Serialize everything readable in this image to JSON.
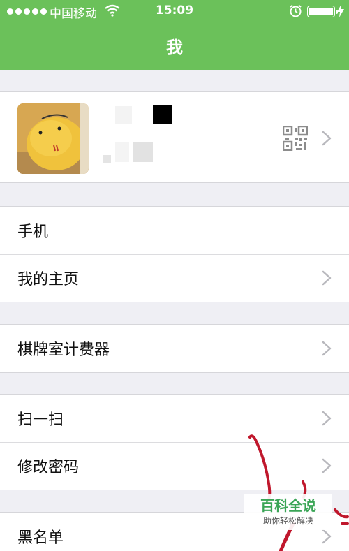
{
  "status_bar": {
    "carrier": "中国移动",
    "time": "15:09"
  },
  "nav": {
    "title": "我"
  },
  "profile": {
    "avatar_icon": "avatar-photo",
    "qr_icon": "qr-code-icon"
  },
  "menu_groups": [
    {
      "items": [
        {
          "label": "手机"
        },
        {
          "label": "我的主页"
        }
      ]
    },
    {
      "items": [
        {
          "label": "棋牌室计费器"
        }
      ]
    },
    {
      "items": [
        {
          "label": "扫一扫"
        },
        {
          "label": "修改密码"
        }
      ]
    },
    {
      "items": [
        {
          "label": "黑名单"
        }
      ]
    }
  ],
  "watermark": {
    "title": "百科全说",
    "subtitle": "助你轻松解决"
  },
  "colors": {
    "nav_bar": "#6bc15a",
    "background": "#efeff4",
    "watermark_green": "#3aa556",
    "scribble": "#c0172c"
  }
}
